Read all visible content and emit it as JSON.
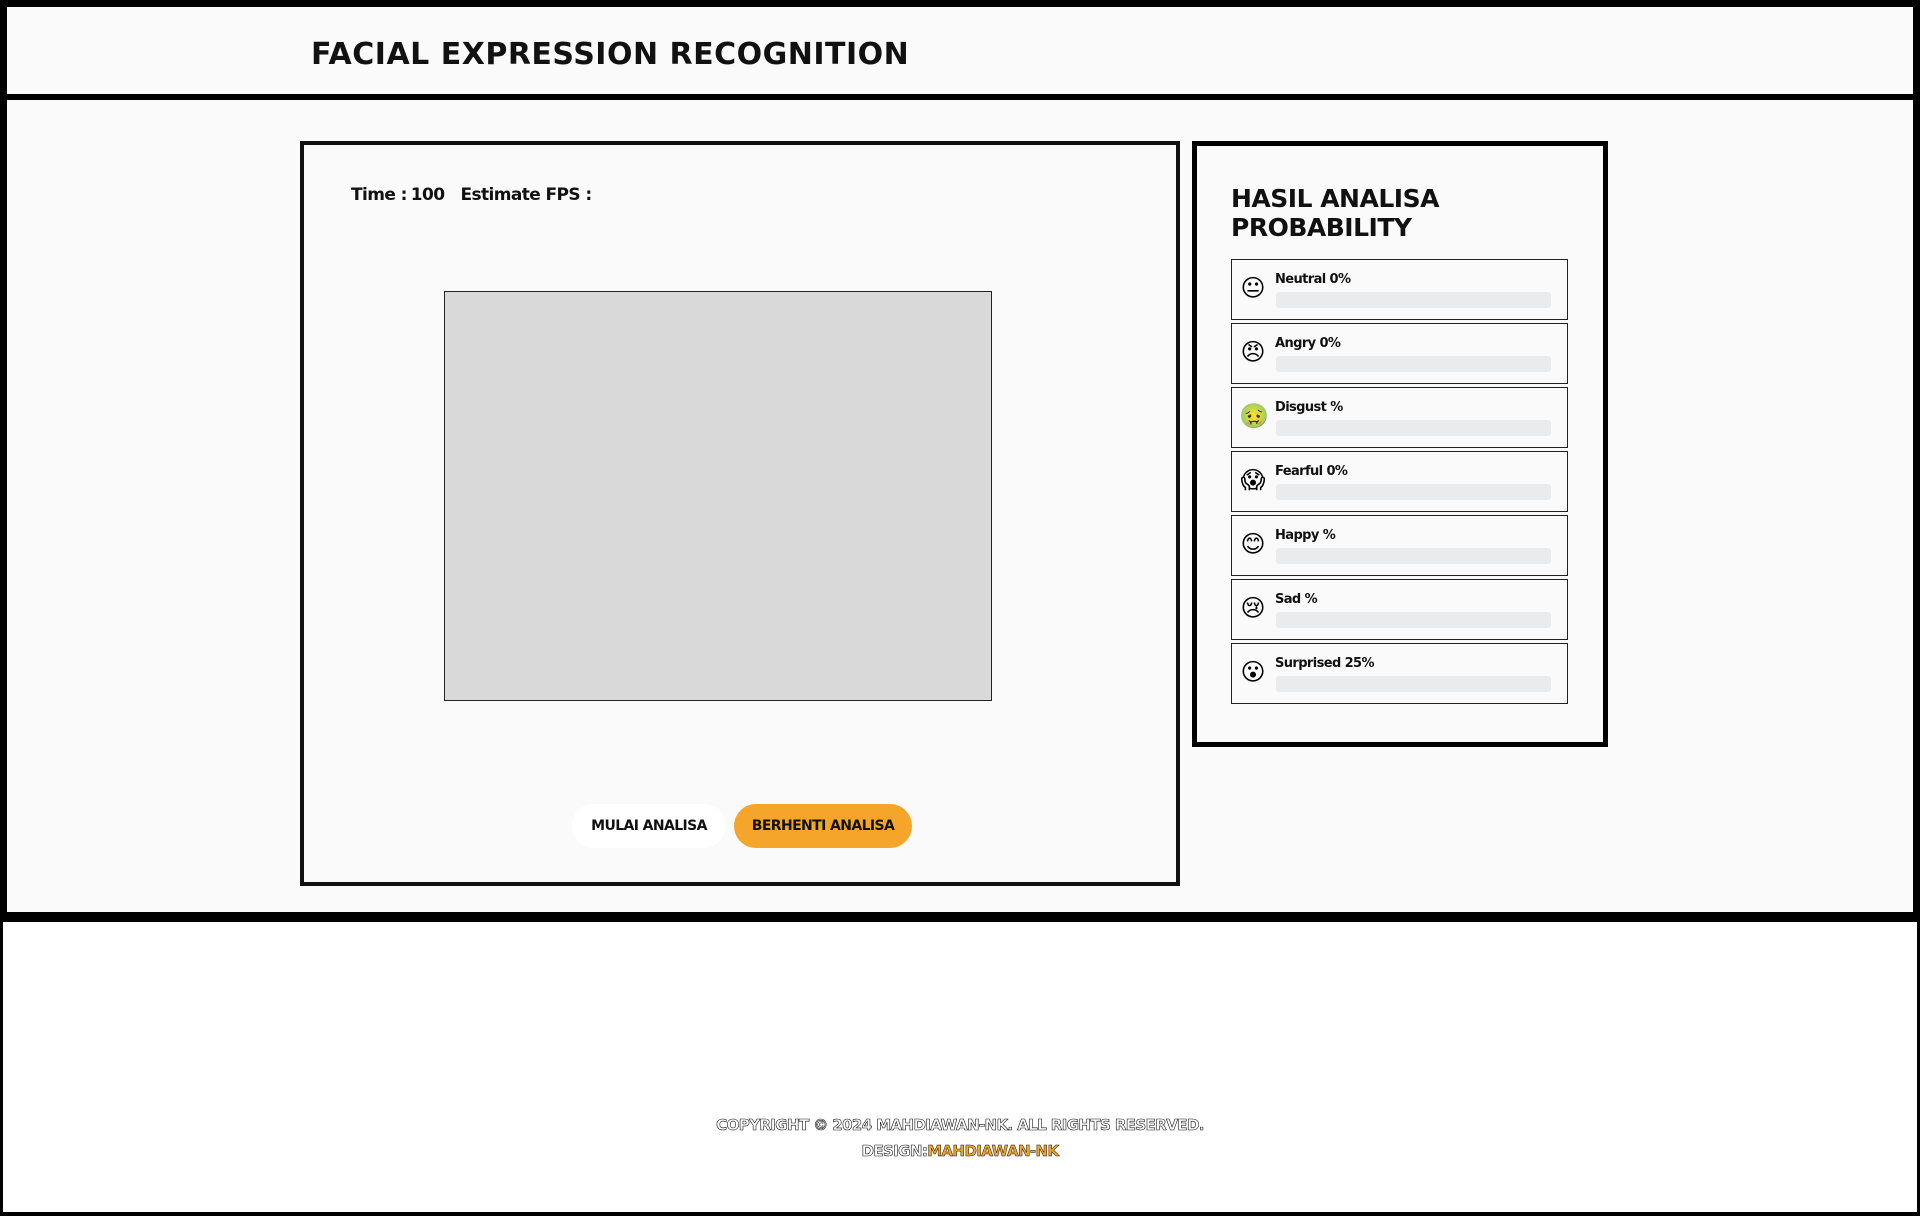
{
  "header": {
    "title": "FACIAL EXPRESSION RECOGNITION"
  },
  "camera": {
    "time_label": "Time :",
    "time_value": "100",
    "fps_label": "Estimate FPS :",
    "fps_value": "",
    "start_button": "MULAI ANALISA",
    "stop_button": "BERHENTI ANALISA"
  },
  "results": {
    "title": "HASIL ANALISA PROBABILITY",
    "items": [
      {
        "name": "Neutral",
        "value": "0",
        "suffix": "%",
        "icon": "neutral-face-icon",
        "glyph": "😐",
        "fraction": 0
      },
      {
        "name": "Angry",
        "value": "0",
        "suffix": "%",
        "icon": "angry-face-icon",
        "glyph": "😠",
        "fraction": 0
      },
      {
        "name": "Disgust",
        "value": "",
        "suffix": "%",
        "icon": "nauseated-face-icon",
        "glyph": "🤢",
        "fraction": 0
      },
      {
        "name": "Fearful",
        "value": "0",
        "suffix": "%",
        "icon": "screaming-face-icon",
        "glyph": "😱",
        "fraction": 0
      },
      {
        "name": "Happy",
        "value": "",
        "suffix": "%",
        "icon": "smiling-face-icon",
        "glyph": "😊",
        "fraction": 0
      },
      {
        "name": "Sad",
        "value": "",
        "suffix": "%",
        "icon": "crying-face-icon",
        "glyph": "😢",
        "fraction": 0
      },
      {
        "name": "Surprised",
        "value": "25",
        "suffix": "%",
        "icon": "surprised-face-icon",
        "glyph": "😮",
        "fraction": 0.25
      }
    ]
  },
  "footer": {
    "copyright": "COPYRIGHT © 2024 MAHDIAWAN-NK. ALL RIGHTS RESERVED.",
    "design_prefix": "DESIGN:",
    "design_name": "MAHDIAWAN-NK"
  },
  "colors": {
    "accent": "#f5a62a",
    "video_placeholder": "#d9d9d9",
    "progress_track": "#e9ebed"
  }
}
